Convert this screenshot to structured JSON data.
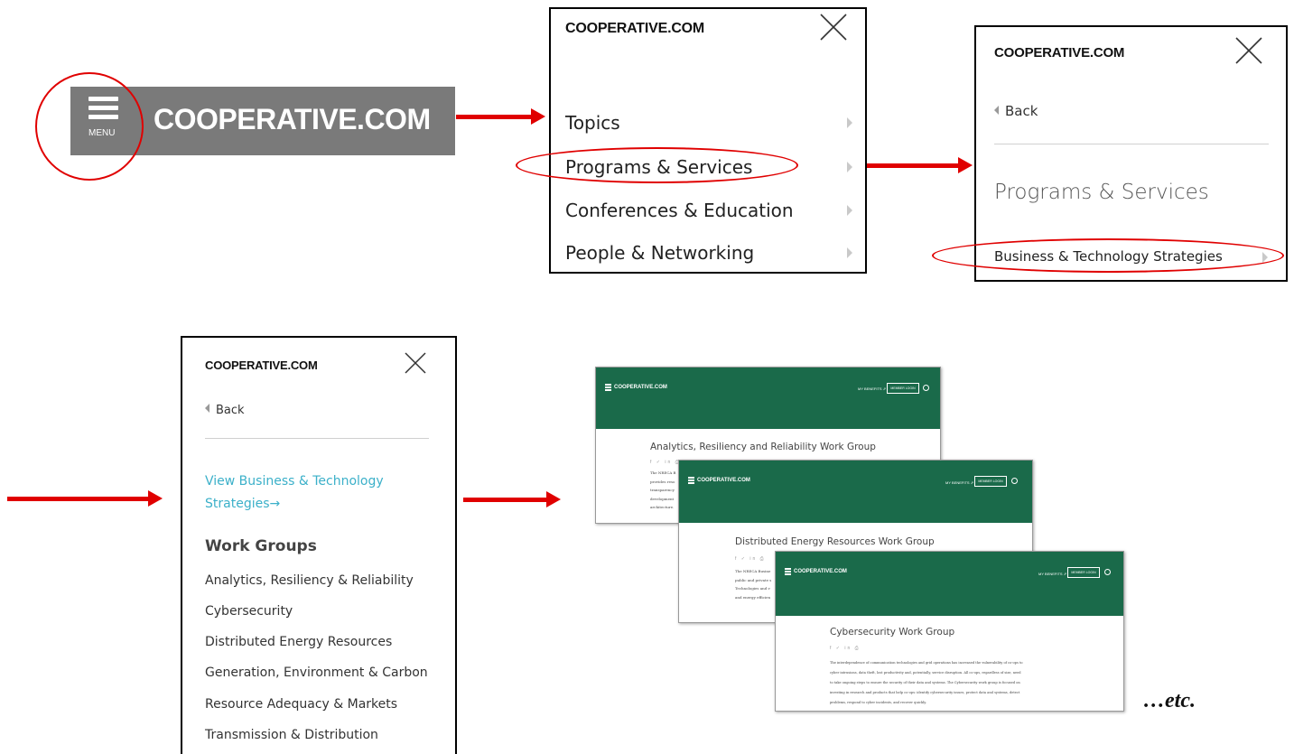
{
  "site_logo": "COOPERATIVE.COM",
  "header": {
    "menu_label": "MENU",
    "logo": "COOPERATIVE.COM"
  },
  "panel1": {
    "logo": "COOPERATIVE.COM",
    "items": [
      "Topics",
      "Programs & Services",
      "Conferences & Education",
      "People & Networking"
    ]
  },
  "panel2": {
    "logo": "COOPERATIVE.COM",
    "back": "Back",
    "section_title": "Programs & Services",
    "item": "Business & Technology Strategies"
  },
  "panel3": {
    "logo": "COOPERATIVE.COM",
    "back": "Back",
    "view_link_line1": "View Business & Technology",
    "view_link_line2": "Strategies→",
    "work_groups_heading": "Work Groups",
    "work_groups": [
      "Analytics, Resiliency & Reliability",
      "Cybersecurity",
      "Distributed Energy Resources",
      "Generation, Environment & Carbon",
      "Resource Adequacy & Markets",
      "Transmission & Distribution"
    ]
  },
  "screenshots": [
    {
      "logo": "COOPERATIVE.COM",
      "benefits": "MY BENEFITS ⇗",
      "login": "MEMBER LOGIN",
      "title": "Analytics, Resiliency and Reliability Work Group",
      "body": [
        "The NRECA B",
        "provides reso",
        "transparency",
        "development",
        "architecture."
      ]
    },
    {
      "logo": "COOPERATIVE.COM",
      "benefits": "MY BENEFITS ⇗",
      "login": "MEMBER LOGIN",
      "title": "Distributed Energy Resources Work Group",
      "body": [
        "The NRECA Busine",
        "public and private s",
        "Technologies and v",
        "and energy efficien"
      ]
    },
    {
      "logo": "COOPERATIVE.COM",
      "benefits": "MY BENEFITS ⇗",
      "login": "MEMBER LOGIN",
      "title": "Cybersecurity Work Group",
      "body": [
        "The interdependence of communication technologies and grid operations has increased the vulnerability of co-ops to",
        "cyber intrusions, data theft, lost productivity and, potentially, service disruption. All co-ops, regardless of size, need",
        "to take ongoing steps to ensure the security of their data and systems. The Cybersecurity work group is focused on",
        "investing in research and products that help co-ops: identify cybersecurity issues, protect data and systems, detect",
        "problems, respond to cyber incidents, and recover quickly."
      ]
    }
  ],
  "social_icons": "f ✓ in ⎙",
  "etc": "…etc.",
  "colors": {
    "accent_red": "#e00000",
    "header_gray": "#7a7a7a",
    "site_green": "#1a6a4a",
    "link_teal": "#3bb0c9"
  }
}
